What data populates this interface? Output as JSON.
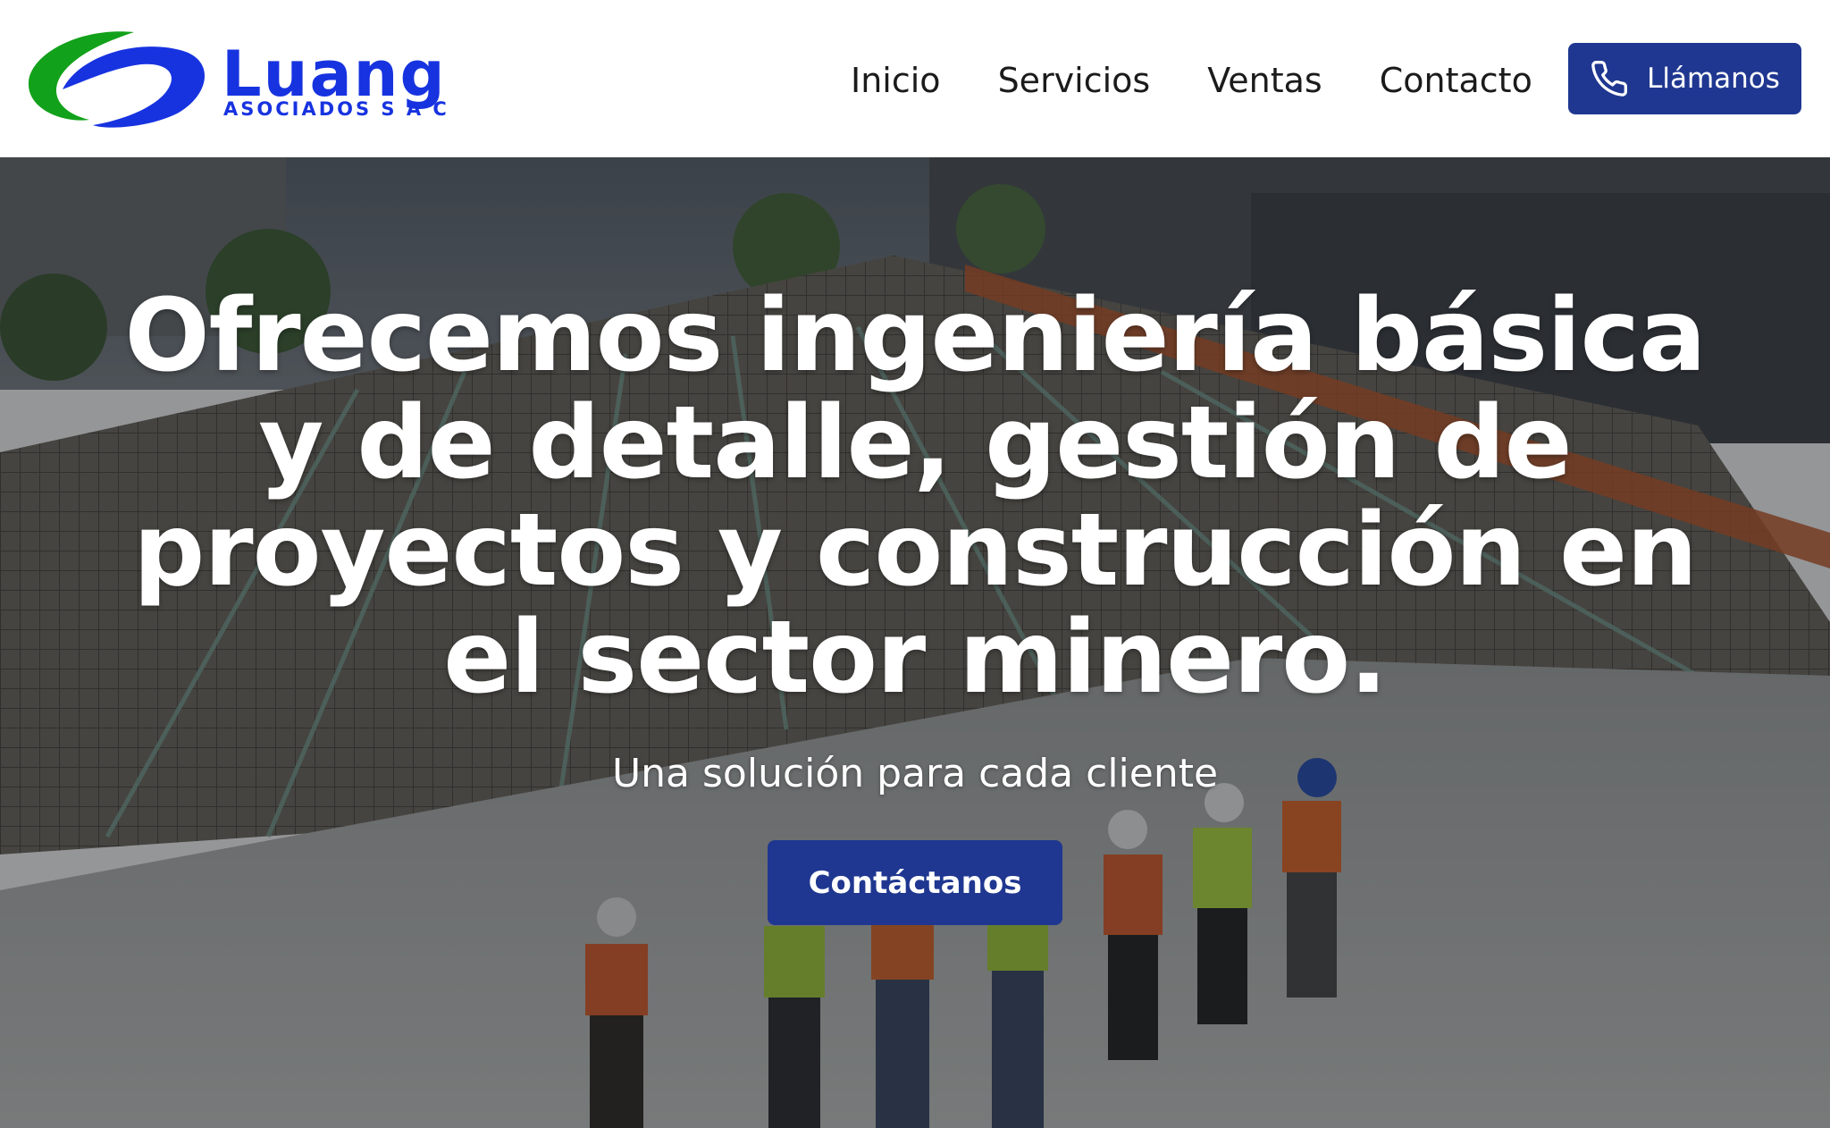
{
  "header": {
    "logo": {
      "name": "Luang",
      "subtitle": "ASOCIADOS S A C",
      "colors": {
        "green": "#12a11a",
        "blue": "#1733e0"
      }
    },
    "nav": [
      {
        "label": "Inicio"
      },
      {
        "label": "Servicios"
      },
      {
        "label": "Ventas"
      },
      {
        "label": "Contacto"
      }
    ],
    "call_button": {
      "label": "Llámanos",
      "icon": "phone-icon"
    }
  },
  "hero": {
    "title": "Ofrecemos ingeniería básica y de detalle, gestión de proyectos y construcción en el sector minero.",
    "subtitle": "Una solución para cada cliente",
    "cta_label": "Contáctanos",
    "background": "construction-site-photo"
  },
  "colors": {
    "accent": "#1f3790",
    "nav_text": "#1b1b1b",
    "hero_text": "#ffffff"
  }
}
